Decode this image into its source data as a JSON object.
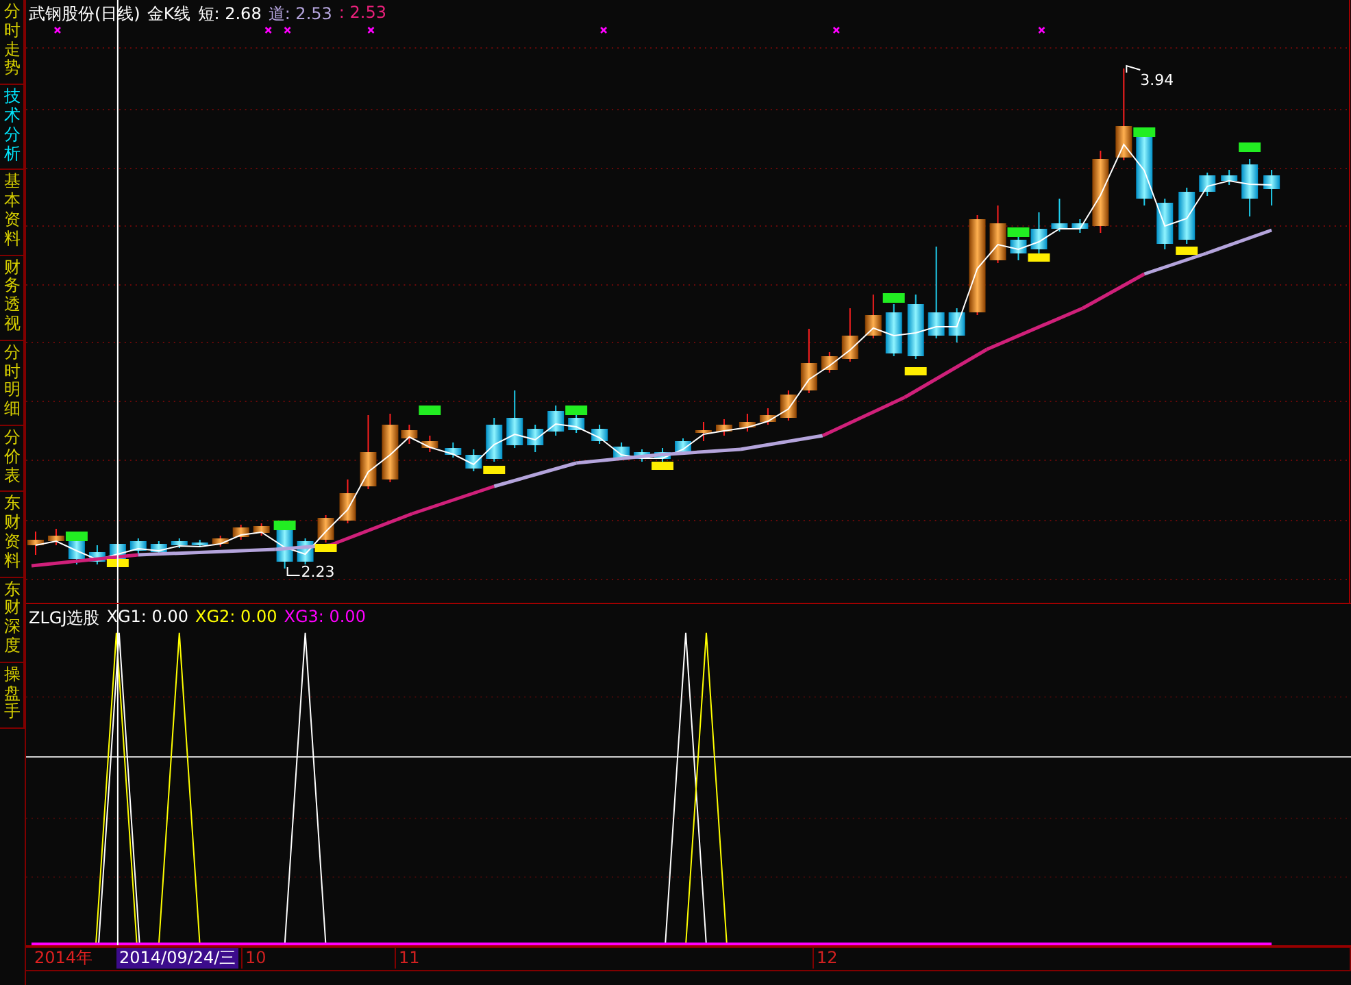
{
  "sidebar": {
    "tabs": [
      {
        "label": "分时走势",
        "selected": false
      },
      {
        "label": "技术分析",
        "selected": true
      },
      {
        "label": "基本资料",
        "selected": false
      },
      {
        "label": "财务透视",
        "selected": false
      },
      {
        "label": "分时明细",
        "selected": false
      },
      {
        "label": "分价表",
        "selected": false
      },
      {
        "label": "东财资料",
        "selected": false
      },
      {
        "label": "东财深度",
        "selected": false
      },
      {
        "label": "操盘手",
        "selected": false
      }
    ]
  },
  "chart": {
    "title": "武钢股份(日线)",
    "indicator_name": "金K线",
    "legend": [
      {
        "label": "短:",
        "value": "2.68",
        "color": "#ffffff"
      },
      {
        "label": "道:",
        "value": "2.53",
        "color": "#b4a4dc"
      },
      {
        "label": ":",
        "value": "2.53",
        "color": "#e8207a"
      }
    ],
    "annotations": [
      {
        "kind": "high",
        "text": "3.94"
      },
      {
        "kind": "low",
        "text": "2.23"
      }
    ]
  },
  "indicator": {
    "name": "ZLGJ选股",
    "values": [
      {
        "label": "XG1:",
        "value": "0.00",
        "color": "#ffffff"
      },
      {
        "label": "XG2:",
        "value": "0.00",
        "color": "#ffff00"
      },
      {
        "label": "XG3:",
        "value": "0.00",
        "color": "#ff00ff"
      }
    ]
  },
  "time_axis": {
    "year": "2014年",
    "cursor_date": "2014/09/24/三",
    "months": [
      "10",
      "11",
      "12"
    ]
  }
}
